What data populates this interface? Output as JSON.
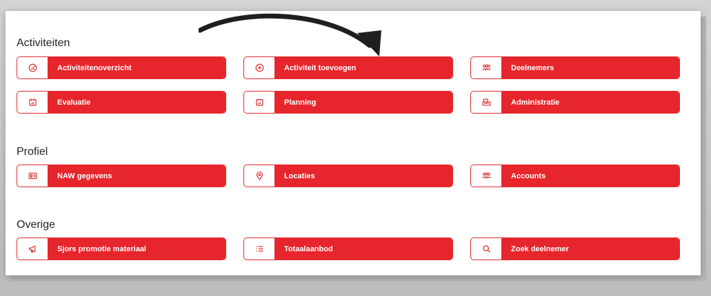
{
  "sections": [
    {
      "title": "Activiteiten",
      "tiles": [
        {
          "label": "Activiteitenoverzicht",
          "icon": "dashboard-icon"
        },
        {
          "label": "Activiteit toevoegen",
          "icon": "add-circle-icon"
        },
        {
          "label": "Deelnemers",
          "icon": "group-icon"
        },
        {
          "label": "Evaluatie",
          "icon": "calendar-check-icon"
        },
        {
          "label": "Planning",
          "icon": "calendar-check-icon"
        },
        {
          "label": "Administratie",
          "icon": "register-icon"
        }
      ]
    },
    {
      "title": "Profiel",
      "tiles": [
        {
          "label": "NAW gegevens",
          "icon": "id-card-icon"
        },
        {
          "label": "Locaties",
          "icon": "location-pin-icon"
        },
        {
          "label": "Accounts",
          "icon": "group-icon"
        }
      ]
    },
    {
      "title": "Overige",
      "tiles": [
        {
          "label": "Sjors promotie materiaal",
          "icon": "megaphone-icon"
        },
        {
          "label": "Totaalaanbod",
          "icon": "list-icon"
        },
        {
          "label": "Zoek deelnemer",
          "icon": "search-icon"
        }
      ]
    }
  ],
  "colors": {
    "accent": "#e6262c",
    "border": "#e02a2f"
  }
}
